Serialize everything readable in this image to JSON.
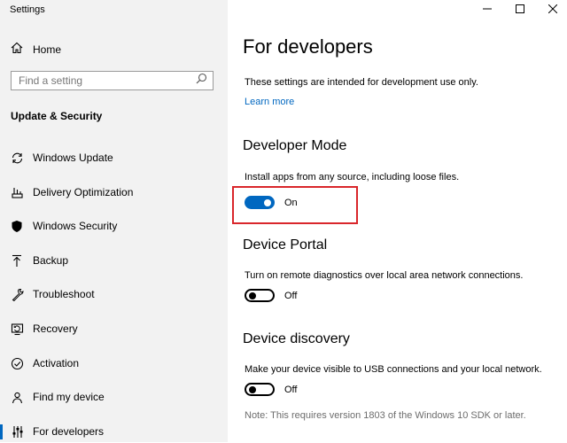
{
  "window": {
    "title": "Settings",
    "controls": [
      "minimize-icon",
      "maximize-icon",
      "close-icon"
    ]
  },
  "sidebar": {
    "home_label": "Home",
    "search_placeholder": "Find a setting",
    "section_title": "Update & Security",
    "items": [
      {
        "label": "Windows Update",
        "icon": "sync-icon"
      },
      {
        "label": "Delivery Optimization",
        "icon": "delivery-optimization-icon"
      },
      {
        "label": "Windows Security",
        "icon": "shield-icon"
      },
      {
        "label": "Backup",
        "icon": "backup-arrow-icon"
      },
      {
        "label": "Troubleshoot",
        "icon": "wrench-icon"
      },
      {
        "label": "Recovery",
        "icon": "recovery-icon"
      },
      {
        "label": "Activation",
        "icon": "check-circle-icon"
      },
      {
        "label": "Find my device",
        "icon": "person-pin-icon"
      },
      {
        "label": "For developers",
        "icon": "developer-sliders-icon",
        "active": true
      }
    ]
  },
  "main": {
    "title": "For developers",
    "intro": "These settings are intended for development use only.",
    "learn_more": "Learn more",
    "developer_mode": {
      "heading": "Developer Mode",
      "description": "Install apps from any source, including loose files.",
      "state": "On"
    },
    "device_portal": {
      "heading": "Device Portal",
      "description": "Turn on remote diagnostics over local area network connections.",
      "state": "Off"
    },
    "device_discovery": {
      "heading": "Device discovery",
      "description": "Make your device visible to USB connections and your local network.",
      "state": "Off",
      "note": "Note: This requires version 1803 of the Windows 10 SDK or later."
    }
  },
  "colors": {
    "accent": "#0067c0",
    "sidebar_bg": "#f2f2f2",
    "highlight_border": "#d9262b"
  }
}
